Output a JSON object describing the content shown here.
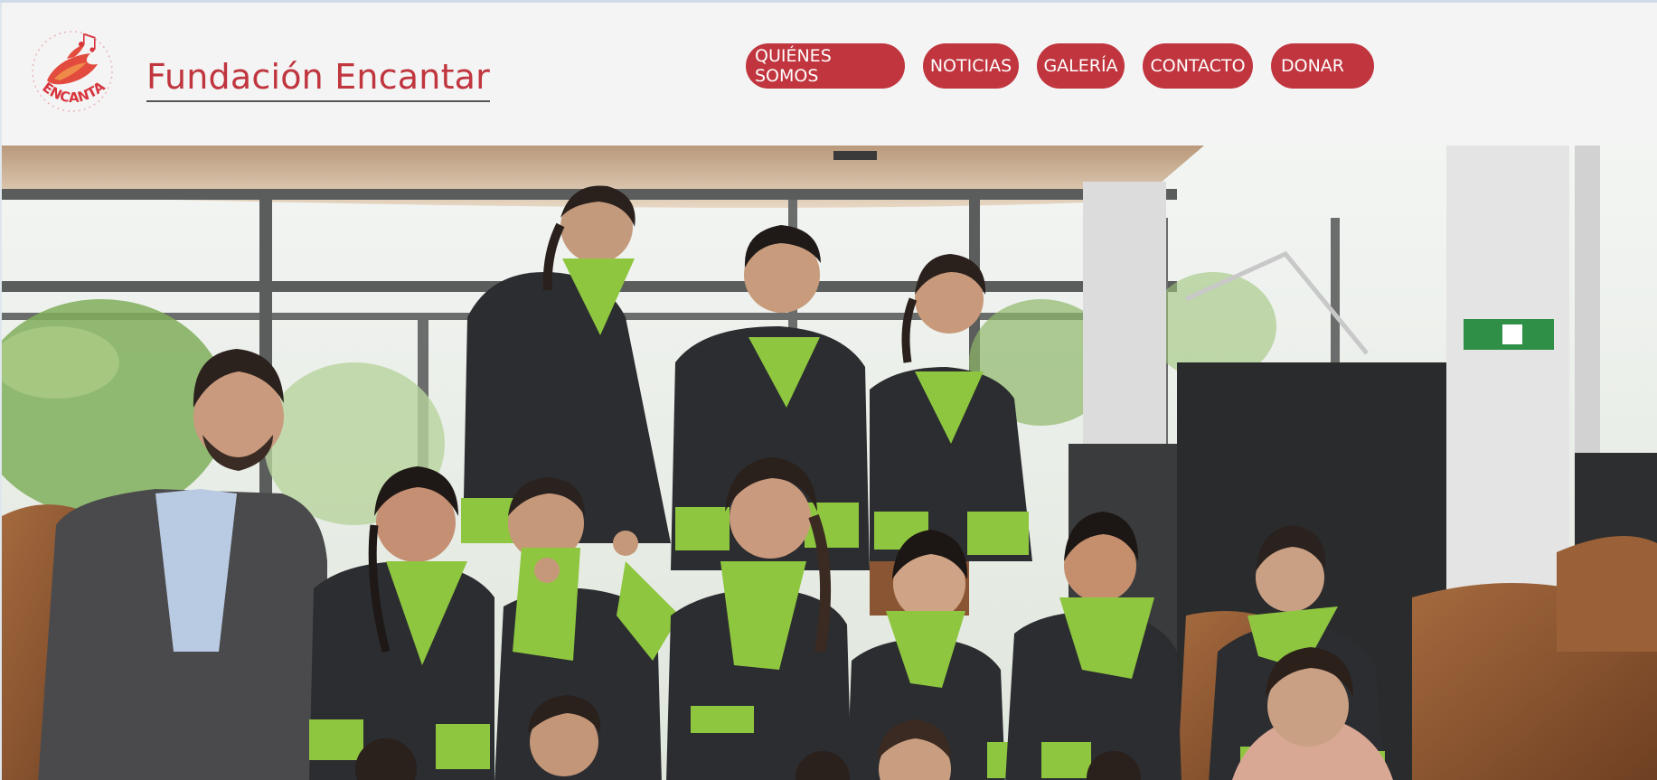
{
  "header": {
    "brand": "Fundación Encantar",
    "logo_text": "ENCANTAR"
  },
  "nav": {
    "items": [
      {
        "label": "QUIÉNES SOMOS"
      },
      {
        "label": "NOTICIAS"
      },
      {
        "label": "GALERÍA"
      },
      {
        "label": "CONTACTO"
      },
      {
        "label": "DONAR"
      }
    ]
  },
  "hero": {
    "description": "Group photo of children's choir in black robes with green scarves",
    "colors": {
      "robe": "#2b2d30",
      "scarf": "#8ec63f",
      "wood": "#8a5532",
      "ceiling": "#cfae8a"
    }
  },
  "theme": {
    "accent": "#c0353e",
    "header_bg": "#f4f4f5"
  }
}
